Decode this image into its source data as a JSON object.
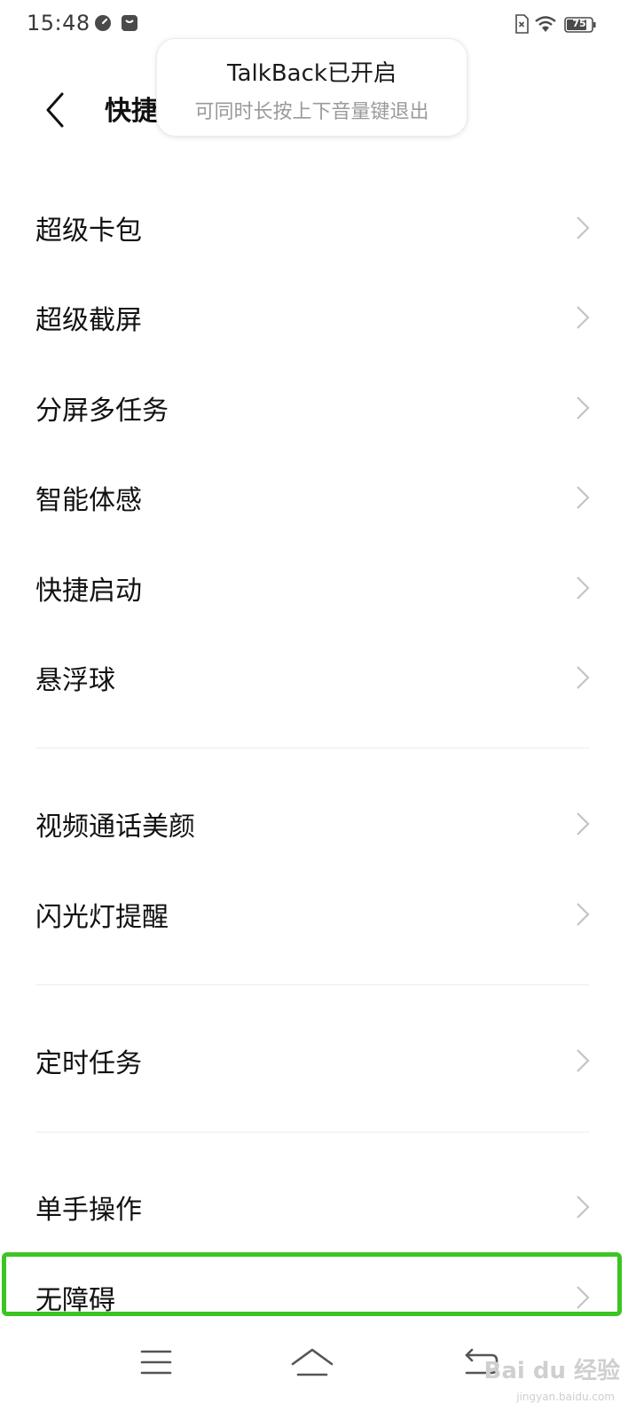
{
  "status_bar": {
    "time": "15:48",
    "battery": "75",
    "icons": [
      "speedometer-icon",
      "notification-icon",
      "no-sim-icon",
      "wifi-icon",
      "battery-icon"
    ]
  },
  "header": {
    "title": "快捷",
    "back_icon": "back-arrow-icon"
  },
  "toast": {
    "title": "TalkBack已开启",
    "subtitle": "可同时长按上下音量键退出"
  },
  "settings": {
    "group1": [
      {
        "label": "超级卡包"
      },
      {
        "label": "超级截屏"
      },
      {
        "label": "分屏多任务"
      },
      {
        "label": "智能体感"
      },
      {
        "label": "快捷启动"
      },
      {
        "label": "悬浮球"
      }
    ],
    "group2": [
      {
        "label": "视频通话美颜"
      },
      {
        "label": "闪光灯提醒"
      }
    ],
    "group3": [
      {
        "label": "定时任务"
      }
    ],
    "group4": [
      {
        "label": "单手操作"
      },
      {
        "label": "无障碍"
      }
    ]
  },
  "highlight": {
    "target": "无障碍",
    "color": "#3cc423"
  },
  "nav_bar": {
    "icons": [
      "menu-icon",
      "home-icon",
      "back-icon"
    ]
  },
  "watermark": {
    "text": "Bai du 经验",
    "sub": "jingyan.baidu.com"
  },
  "colors": {
    "divider": "#ececec",
    "chevron": "#c4c4c4",
    "accent": "#3cc423"
  }
}
